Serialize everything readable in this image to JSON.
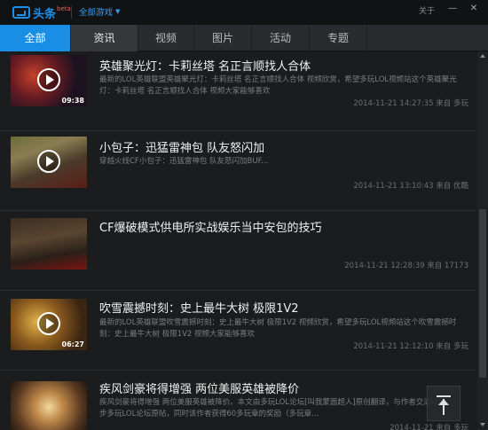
{
  "app": {
    "logo_text": "头条",
    "logo_beta": "beta",
    "game_select": "全部游戏",
    "about": "关于",
    "minimize_glyph": "—",
    "close_glyph": "✕"
  },
  "tabs": [
    {
      "label": "全部"
    },
    {
      "label": "资讯"
    },
    {
      "label": "视频"
    },
    {
      "label": "图片"
    },
    {
      "label": "活动"
    },
    {
      "label": "专题"
    }
  ],
  "feed": [
    {
      "title": "英雄聚光灯：卡莉丝塔 名正言顺找人合体",
      "desc": "最新的LOL英雄联盟英雄聚光灯：卡莉丝塔 名正言顺找人合体 视频欣赏，希望多玩LOL视频站这个英雄聚光灯：卡莉丝塔 名正言顺找人合体 视频大家能够喜欢",
      "meta": "2014-11-21 14:27:35 来自 多玩",
      "duration": "09:38",
      "has_play": true
    },
    {
      "title": "小包子：迅猛雷神包 队友怒闪加",
      "desc": "穿越火线CF小包子：迅猛雷神包 队友怒闪加BUF...",
      "meta": "2014-11-21 13:10:43 来自 优酷",
      "duration": "",
      "has_play": true
    },
    {
      "title": "CF爆破模式供电所实战娱乐当中安包的技巧",
      "desc": "",
      "meta": "2014-11-21 12:28:39 来自 17173",
      "duration": "",
      "has_play": false
    },
    {
      "title": "吹雪震撼时刻：史上最牛大树 极限1V2",
      "desc": "最新的LOL英雄联盟吹雪震撼时刻：史上最牛大树 极限1V2 视频欣赏，希望多玩LOL视频站这个吹雪震撼时刻：史上最牛大树 极限1V2 视频大家能够喜欢",
      "meta": "2014-11-21 12:12:10 来自 多玩",
      "duration": "06:27",
      "has_play": true
    },
    {
      "title": "疾风剑豪将得增强 两位美服英雄被降价",
      "desc": "疾风剑豪将得增强 两位美服英雄被降价。本文由多玩LOL论坛[叫我蒙面超人]原创翻译，与作者交流请移步多玩LOL论坛原帖，同时该作者获得60多玩章的奖励（多玩章...",
      "meta": "2014-11-21 来自 多玩",
      "duration": "",
      "has_play": false
    }
  ],
  "colors": {
    "accent": "#1a8ee4",
    "background": "#1b1c1e",
    "title_text": "#f0f0f0",
    "muted_text": "#7b7c80"
  }
}
